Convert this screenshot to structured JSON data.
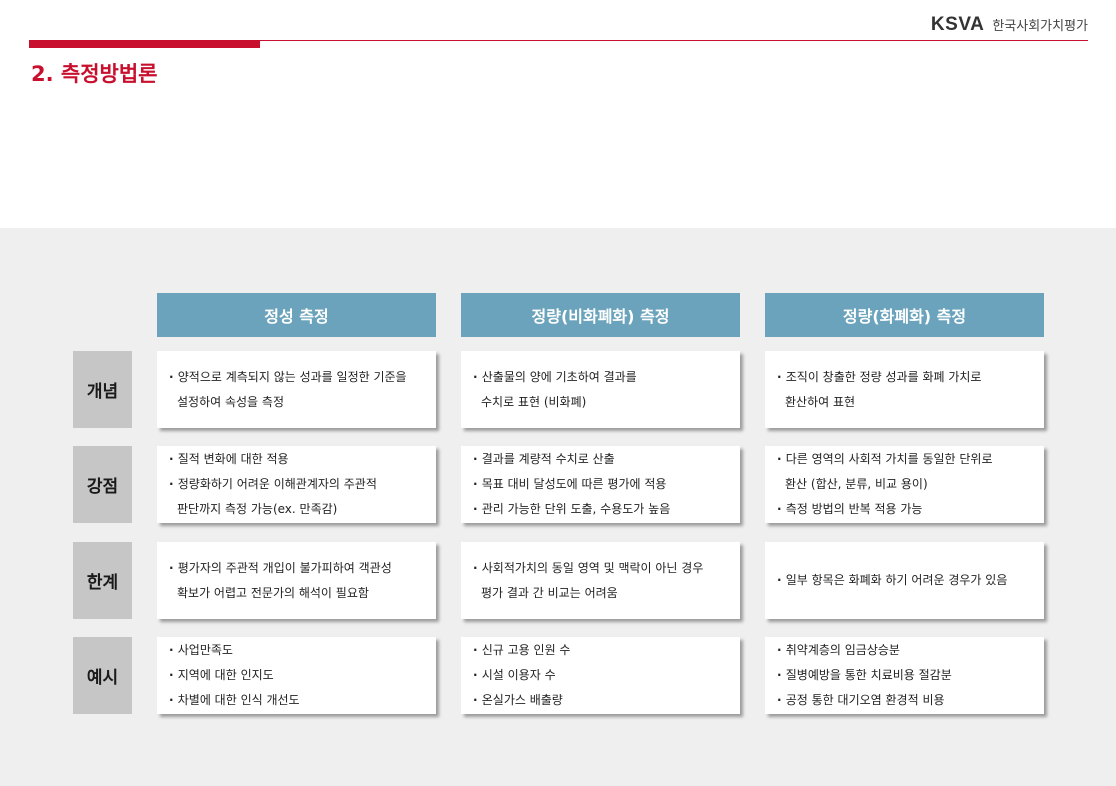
{
  "header": {
    "brand_logo": "KSVA",
    "brand_name": "한국사회가치평가",
    "page_title": "2. 측정방법론"
  },
  "table": {
    "columns": [
      "정성 측정",
      "정량(비화폐화) 측정",
      "정량(화폐화) 측정"
    ],
    "rows": [
      {
        "label": "개념",
        "cells": [
          [
            [
              "bul",
              "양적으로 계측되지 않는 성과를 일정한 기준을"
            ],
            [
              "cont",
              "설정하여 속성을 측정"
            ]
          ],
          [
            [
              "bul",
              "산출물의 양에 기초하여 결과를"
            ],
            [
              "cont",
              "수치로 표현 (비화폐)"
            ]
          ],
          [
            [
              "bul",
              "조직이 창출한 정량 성과를 화폐 가치로"
            ],
            [
              "cont",
              "환산하여 표현"
            ]
          ]
        ]
      },
      {
        "label": "강점",
        "cells": [
          [
            [
              "bul",
              "질적 변화에 대한 적용"
            ],
            [
              "bul",
              "정량화하기 어려운 이해관계자의 주관적"
            ],
            [
              "cont",
              "판단까지 측정 가능(ex. 만족감)"
            ]
          ],
          [
            [
              "bul",
              "결과를 계량적 수치로 산출"
            ],
            [
              "bul",
              "목표 대비 달성도에 따른 평가에 적용"
            ],
            [
              "bul",
              "관리 가능한 단위 도출, 수용도가 높음"
            ]
          ],
          [
            [
              "bul",
              "다른 영역의 사회적 가치를 동일한 단위로"
            ],
            [
              "cont",
              "환산 (합산, 분류, 비교 용이)"
            ],
            [
              "bul",
              "측정 방법의 반복 적용 가능"
            ]
          ]
        ]
      },
      {
        "label": "한계",
        "cells": [
          [
            [
              "bul",
              "평가자의 주관적 개입이 불가피하여 객관성"
            ],
            [
              "cont",
              "확보가 어렵고 전문가의 해석이 필요함"
            ]
          ],
          [
            [
              "bul",
              "사회적가치의 동일 영역 및 맥락이 아닌 경우"
            ],
            [
              "cont",
              "평가 결과 간 비교는 어려움"
            ]
          ],
          [
            [
              "bul",
              "일부 항목은 화폐화 하기 어려운 경우가 있음"
            ]
          ]
        ]
      },
      {
        "label": "예시",
        "cells": [
          [
            [
              "bul",
              "사업만족도"
            ],
            [
              "bul",
              "지역에 대한 인지도"
            ],
            [
              "bul",
              "차별에 대한 인식 개선도"
            ]
          ],
          [
            [
              "bul",
              "신규 고용 인원 수"
            ],
            [
              "bul",
              "시설 이용자 수"
            ],
            [
              "bul",
              "온실가스 배출량"
            ]
          ],
          [
            [
              "bul",
              "취약계층의 임금상승분"
            ],
            [
              "bul",
              "질병예방을 통한 치료비용 절감분"
            ],
            [
              "bul",
              "공정 통한 대기오염 환경적 비용"
            ]
          ]
        ]
      }
    ]
  },
  "colors": {
    "accent": "#c8102e",
    "column_header": "#6aa3bb",
    "row_label": "#c6c6c6",
    "panel": "#efefef"
  }
}
